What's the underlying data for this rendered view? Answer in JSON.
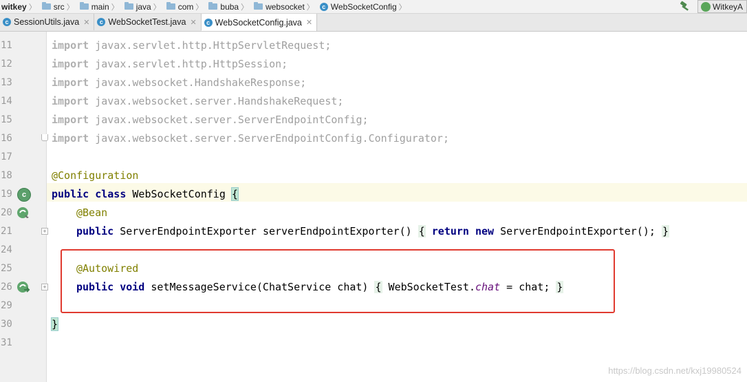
{
  "breadcrumbs": [
    "witkey",
    "src",
    "main",
    "java",
    "com",
    "buba",
    "websocket",
    "WebSocketConfig"
  ],
  "run_config_label": "WitkeyA",
  "tabs": [
    {
      "label": "SessionUtils.java",
      "active": false
    },
    {
      "label": "WebSocketTest.java",
      "active": false
    },
    {
      "label": "WebSocketConfig.java",
      "active": true
    }
  ],
  "line_numbers": [
    "11",
    "12",
    "13",
    "14",
    "15",
    "16",
    "17",
    "18",
    "19",
    "20",
    "21",
    "24",
    "25",
    "26",
    "29",
    "30",
    "31"
  ],
  "code": {
    "import_kw": "import",
    "imports": [
      "javax.servlet.http.HttpServletRequest;",
      "javax.servlet.http.HttpSession;",
      "javax.websocket.HandshakeResponse;",
      "javax.websocket.server.HandshakeRequest;",
      "javax.websocket.server.ServerEndpointConfig;",
      "javax.websocket.server.ServerEndpointConfig.Configurator;"
    ],
    "class_annotation": "@Configuration",
    "kw_public": "public",
    "kw_class": "class",
    "class_name": "WebSocketConfig",
    "open_brace": "{",
    "close_brace": "}",
    "bean_annotation": "@Bean",
    "bean_type": "ServerEndpointExporter",
    "bean_method": "serverEndpointExporter()",
    "kw_return": "return",
    "kw_new": "new",
    "bean_ctor": "ServerEndpointExporter();",
    "autowired_annotation": "@Autowired",
    "kw_void": "void",
    "setter_signature": "setMessageService(ChatService chat)",
    "setter_target": "WebSocketTest.",
    "setter_field": "chat",
    "setter_assign": "= chat;"
  },
  "watermark": "https://blog.csdn.net/kxj19980524",
  "colors": {
    "keyword": "#000080",
    "annotation": "#808000",
    "field": "#660e7a",
    "highlight_box": "#e03a2f"
  }
}
